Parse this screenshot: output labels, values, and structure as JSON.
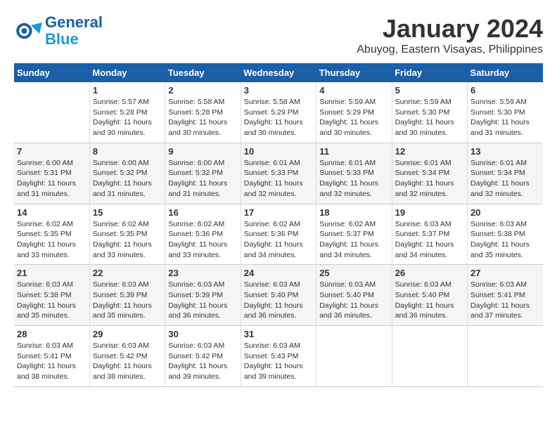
{
  "logo": {
    "line1": "General",
    "line2": "Blue"
  },
  "title": "January 2024",
  "location": "Abuyog, Eastern Visayas, Philippines",
  "days_of_week": [
    "Sunday",
    "Monday",
    "Tuesday",
    "Wednesday",
    "Thursday",
    "Friday",
    "Saturday"
  ],
  "weeks": [
    [
      {
        "day": "",
        "info": ""
      },
      {
        "day": "1",
        "info": "Sunrise: 5:57 AM\nSunset: 5:28 PM\nDaylight: 11 hours\nand 30 minutes."
      },
      {
        "day": "2",
        "info": "Sunrise: 5:58 AM\nSunset: 5:28 PM\nDaylight: 11 hours\nand 30 minutes."
      },
      {
        "day": "3",
        "info": "Sunrise: 5:58 AM\nSunset: 5:29 PM\nDaylight: 11 hours\nand 30 minutes."
      },
      {
        "day": "4",
        "info": "Sunrise: 5:59 AM\nSunset: 5:29 PM\nDaylight: 11 hours\nand 30 minutes."
      },
      {
        "day": "5",
        "info": "Sunrise: 5:59 AM\nSunset: 5:30 PM\nDaylight: 11 hours\nand 30 minutes."
      },
      {
        "day": "6",
        "info": "Sunrise: 5:59 AM\nSunset: 5:30 PM\nDaylight: 11 hours\nand 31 minutes."
      }
    ],
    [
      {
        "day": "7",
        "info": "Sunrise: 6:00 AM\nSunset: 5:31 PM\nDaylight: 11 hours\nand 31 minutes."
      },
      {
        "day": "8",
        "info": "Sunrise: 6:00 AM\nSunset: 5:32 PM\nDaylight: 11 hours\nand 31 minutes."
      },
      {
        "day": "9",
        "info": "Sunrise: 6:00 AM\nSunset: 5:32 PM\nDaylight: 11 hours\nand 31 minutes."
      },
      {
        "day": "10",
        "info": "Sunrise: 6:01 AM\nSunset: 5:33 PM\nDaylight: 11 hours\nand 32 minutes."
      },
      {
        "day": "11",
        "info": "Sunrise: 6:01 AM\nSunset: 5:33 PM\nDaylight: 11 hours\nand 32 minutes."
      },
      {
        "day": "12",
        "info": "Sunrise: 6:01 AM\nSunset: 5:34 PM\nDaylight: 11 hours\nand 32 minutes."
      },
      {
        "day": "13",
        "info": "Sunrise: 6:01 AM\nSunset: 5:34 PM\nDaylight: 11 hours\nand 32 minutes."
      }
    ],
    [
      {
        "day": "14",
        "info": "Sunrise: 6:02 AM\nSunset: 5:35 PM\nDaylight: 11 hours\nand 33 minutes."
      },
      {
        "day": "15",
        "info": "Sunrise: 6:02 AM\nSunset: 5:35 PM\nDaylight: 11 hours\nand 33 minutes."
      },
      {
        "day": "16",
        "info": "Sunrise: 6:02 AM\nSunset: 5:36 PM\nDaylight: 11 hours\nand 33 minutes."
      },
      {
        "day": "17",
        "info": "Sunrise: 6:02 AM\nSunset: 5:36 PM\nDaylight: 11 hours\nand 34 minutes."
      },
      {
        "day": "18",
        "info": "Sunrise: 6:02 AM\nSunset: 5:37 PM\nDaylight: 11 hours\nand 34 minutes."
      },
      {
        "day": "19",
        "info": "Sunrise: 6:03 AM\nSunset: 5:37 PM\nDaylight: 11 hours\nand 34 minutes."
      },
      {
        "day": "20",
        "info": "Sunrise: 6:03 AM\nSunset: 5:38 PM\nDaylight: 11 hours\nand 35 minutes."
      }
    ],
    [
      {
        "day": "21",
        "info": "Sunrise: 6:03 AM\nSunset: 5:38 PM\nDaylight: 11 hours\nand 35 minutes."
      },
      {
        "day": "22",
        "info": "Sunrise: 6:03 AM\nSunset: 5:39 PM\nDaylight: 11 hours\nand 35 minutes."
      },
      {
        "day": "23",
        "info": "Sunrise: 6:03 AM\nSunset: 5:39 PM\nDaylight: 11 hours\nand 36 minutes."
      },
      {
        "day": "24",
        "info": "Sunrise: 6:03 AM\nSunset: 5:40 PM\nDaylight: 11 hours\nand 36 minutes."
      },
      {
        "day": "25",
        "info": "Sunrise: 6:03 AM\nSunset: 5:40 PM\nDaylight: 11 hours\nand 36 minutes."
      },
      {
        "day": "26",
        "info": "Sunrise: 6:03 AM\nSunset: 5:40 PM\nDaylight: 11 hours\nand 36 minutes."
      },
      {
        "day": "27",
        "info": "Sunrise: 6:03 AM\nSunset: 5:41 PM\nDaylight: 11 hours\nand 37 minutes."
      }
    ],
    [
      {
        "day": "28",
        "info": "Sunrise: 6:03 AM\nSunset: 5:41 PM\nDaylight: 11 hours\nand 38 minutes."
      },
      {
        "day": "29",
        "info": "Sunrise: 6:03 AM\nSunset: 5:42 PM\nDaylight: 11 hours\nand 38 minutes."
      },
      {
        "day": "30",
        "info": "Sunrise: 6:03 AM\nSunset: 5:42 PM\nDaylight: 11 hours\nand 39 minutes."
      },
      {
        "day": "31",
        "info": "Sunrise: 6:03 AM\nSunset: 5:43 PM\nDaylight: 11 hours\nand 39 minutes."
      },
      {
        "day": "",
        "info": ""
      },
      {
        "day": "",
        "info": ""
      },
      {
        "day": "",
        "info": ""
      }
    ]
  ]
}
